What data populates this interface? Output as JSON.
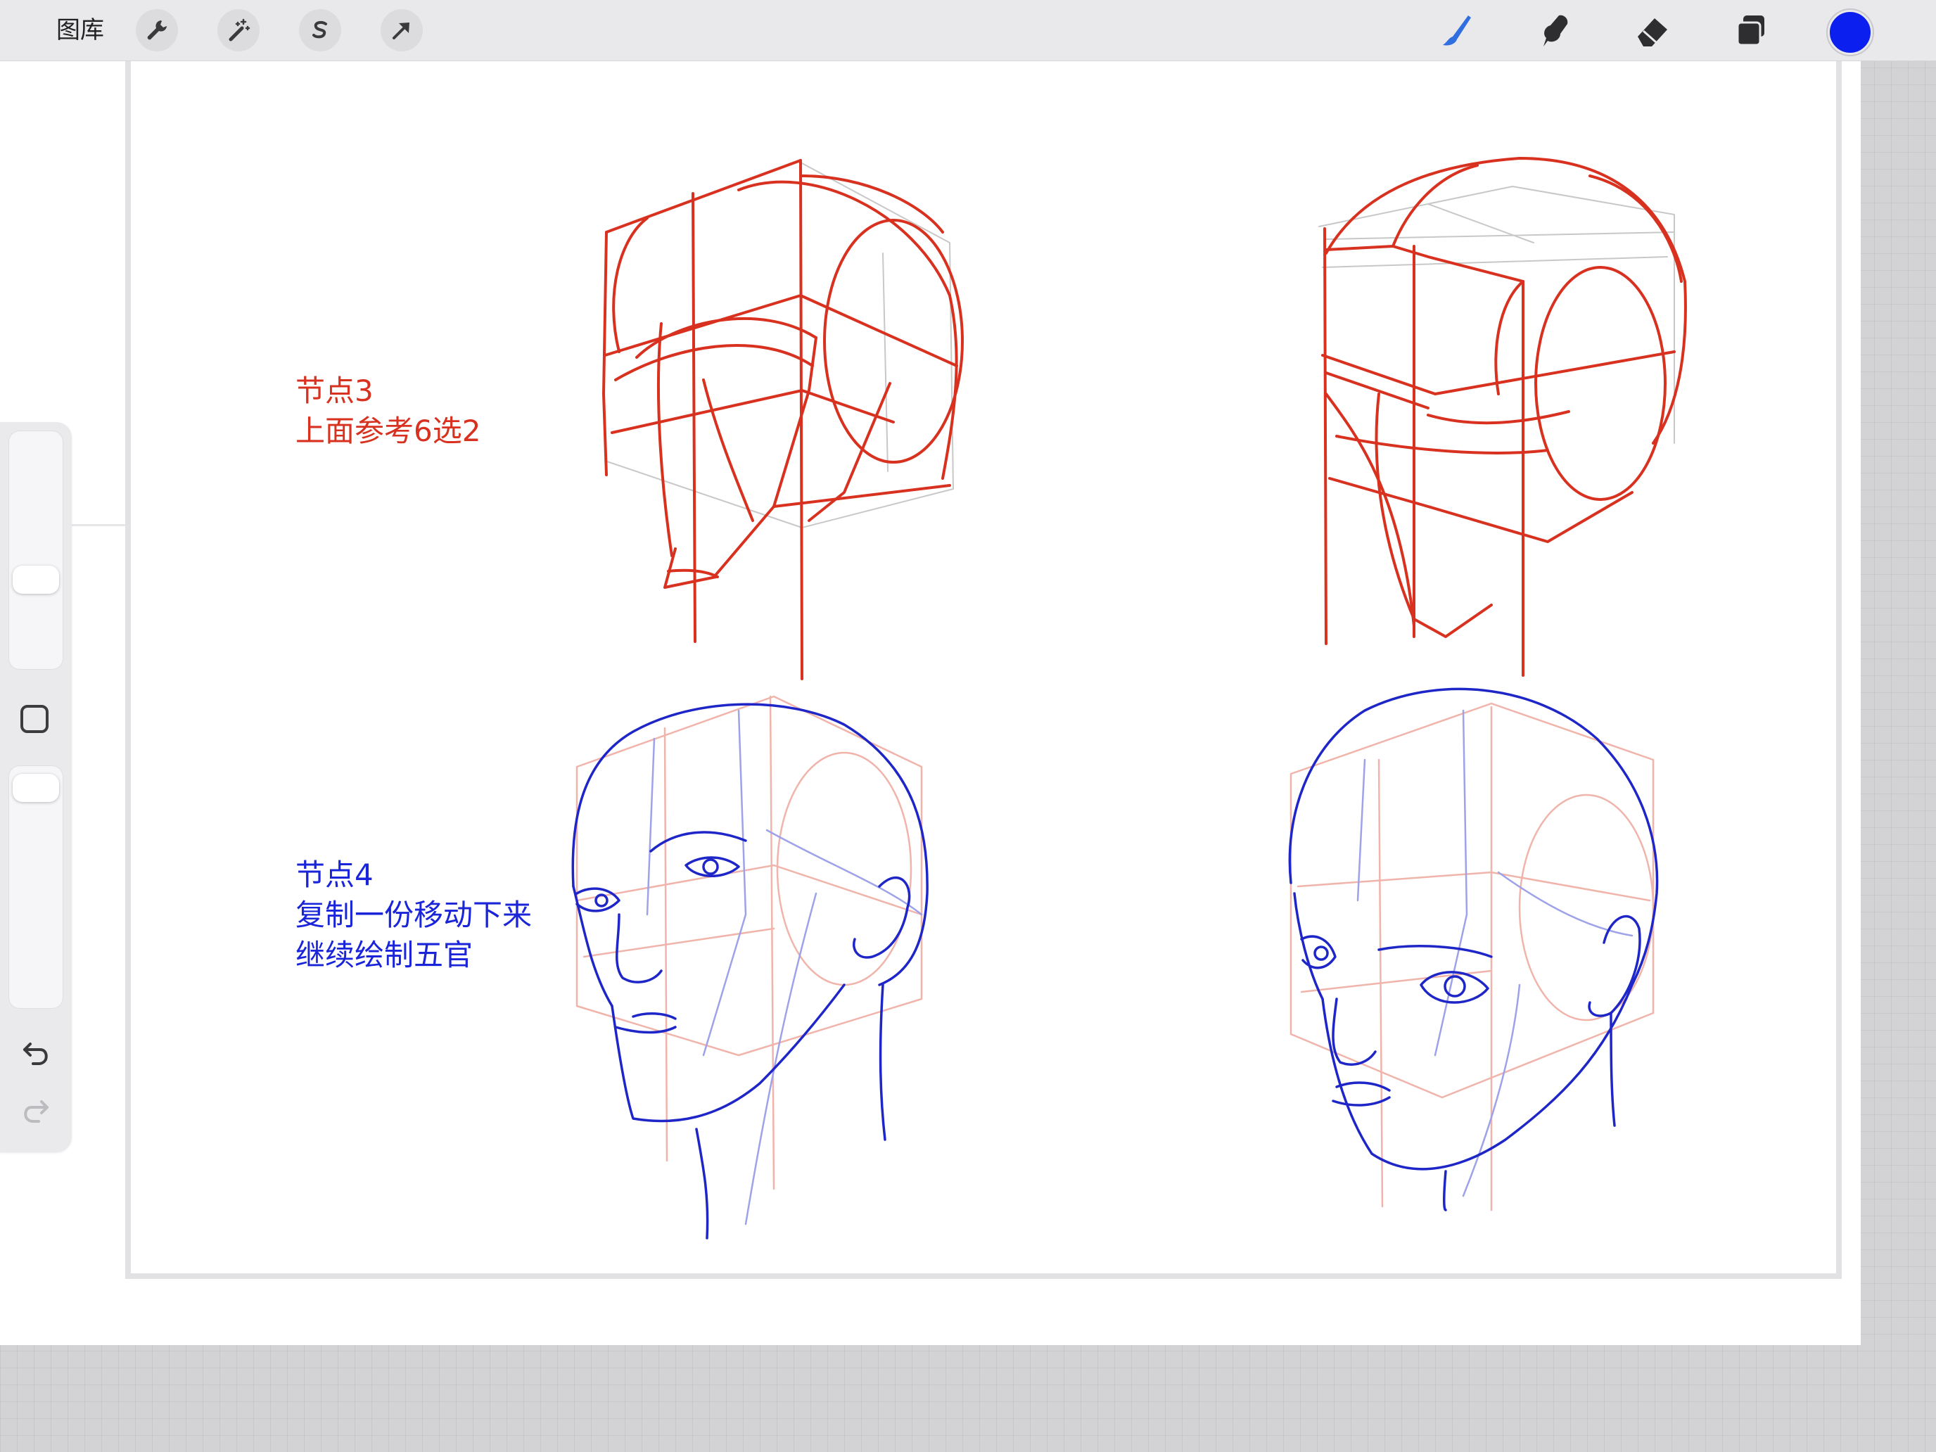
{
  "topbar": {
    "gallery_label": "图库",
    "tools_left": [
      {
        "name": "actions",
        "icon": "wrench-icon"
      },
      {
        "name": "adjustments",
        "icon": "magic-wand-icon"
      },
      {
        "name": "selection",
        "icon": "selection-s-icon"
      },
      {
        "name": "transform",
        "icon": "arrow-cursor-icon"
      }
    ],
    "tools_right": [
      {
        "name": "brush",
        "icon": "brush-icon",
        "active": true
      },
      {
        "name": "smudge",
        "icon": "smudge-icon"
      },
      {
        "name": "eraser",
        "icon": "eraser-icon"
      },
      {
        "name": "layers",
        "icon": "layers-icon"
      }
    ],
    "current_color": "#0b1fef"
  },
  "canvas": {
    "notes": [
      {
        "lines": [
          "节点3",
          "上面参考6选2"
        ],
        "color": "#d8311f"
      },
      {
        "lines": [
          "节点4",
          "复制一份移动下来",
          "继续绘制五官"
        ],
        "color": "#1a24d8"
      }
    ],
    "stroke_colors": {
      "construction_red": "#d8311f",
      "light_red": "#f0b4ab",
      "ink_blue": "#1e26c8",
      "light_blue": "#9ea2e8",
      "guide_gray": "#c8c8c8"
    }
  },
  "sidebar": {
    "controls": [
      "brush-size-slider",
      "modify-button",
      "opacity-slider",
      "undo-button",
      "redo-button"
    ]
  }
}
